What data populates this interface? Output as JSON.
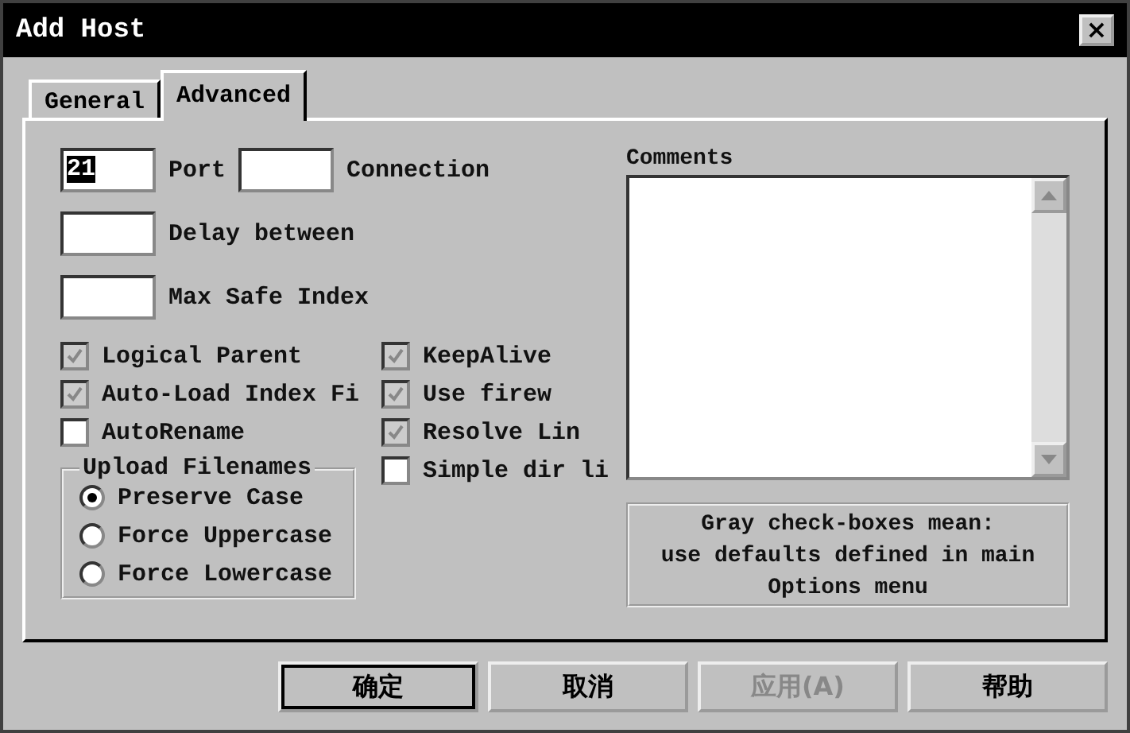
{
  "window": {
    "title": "Add Host",
    "close": "×"
  },
  "tabs": [
    {
      "label": "General",
      "selected": false
    },
    {
      "label": "Advanced",
      "selected": true
    }
  ],
  "fields": [
    {
      "label": "Port",
      "value": "21",
      "selected_text": true
    },
    {
      "label": "Connection"
    },
    {
      "label": "Delay between"
    },
    {
      "label": "Max Safe Index"
    }
  ],
  "options_left": [
    {
      "label": "Logical Parent",
      "checked": true,
      "grayed": true
    },
    {
      "label": "Auto-Load Index Fi",
      "checked": true,
      "grayed": true
    },
    {
      "label": "AutoRename",
      "checked": false,
      "grayed": false
    }
  ],
  "upload_filenames": {
    "title": "Upload Filenames",
    "options": [
      {
        "label": "Preserve Case",
        "selected": true
      },
      {
        "label": "Force Uppercase",
        "selected": false
      },
      {
        "label": "Force Lowercase",
        "selected": false
      }
    ]
  },
  "options_right": [
    {
      "label": "KeepAlive",
      "checked": true,
      "grayed": true
    },
    {
      "label": "Use firew",
      "checked": true,
      "grayed": true
    },
    {
      "label": "Resolve Lin",
      "checked": true,
      "grayed": true
    },
    {
      "label": "Simple dir li",
      "checked": false,
      "grayed": false
    }
  ],
  "comments": {
    "label": "Comments"
  },
  "note": "Gray check-boxes mean:\nuse defaults defined in main\nOptions menu",
  "buttons": [
    {
      "label": "确定",
      "default": true,
      "disabled": false
    },
    {
      "label": "取消",
      "default": false,
      "disabled": false
    },
    {
      "label": "应用(A)",
      "default": false,
      "disabled": true
    },
    {
      "label": "帮助",
      "default": false,
      "disabled": false
    }
  ]
}
